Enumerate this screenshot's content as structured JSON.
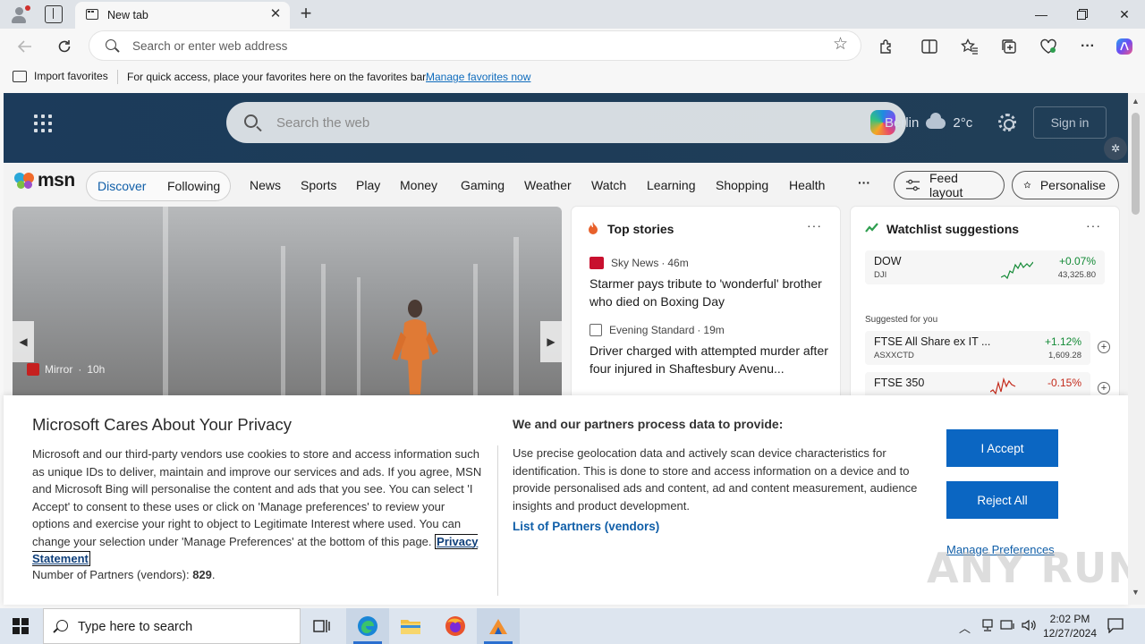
{
  "browser": {
    "tab_title": "New tab",
    "address_placeholder": "Search or enter web address",
    "favorites_bar": {
      "import_label": "Import favorites",
      "message": "For quick access, place your favorites here on the favorites bar.",
      "link": "Manage favorites now"
    }
  },
  "msn": {
    "search_placeholder": "Search the web",
    "city": "Berlin",
    "temperature": "2°c",
    "sign_in": "Sign in",
    "logo_text": "msn",
    "segments": [
      "Discover",
      "Following"
    ],
    "nav_items": [
      "News",
      "Sports",
      "Play",
      "Money",
      "Gaming",
      "Weather",
      "Watch",
      "Learning",
      "Shopping",
      "Health"
    ],
    "more": "···",
    "feed_layout": "Feed layout",
    "personalise": "Personalise",
    "hero": {
      "source": "Mirror",
      "age": "10h"
    },
    "top_stories": {
      "title": "Top stories",
      "items": [
        {
          "source": "Sky News",
          "age": "46m",
          "headline": "Starmer pays tribute to 'wonderful' brother who died on Boxing Day"
        },
        {
          "source": "Evening Standard",
          "age": "19m",
          "headline": "Driver charged with attempted murder after four injured in Shaftesbury Avenu..."
        }
      ]
    },
    "watchlist": {
      "title": "Watchlist suggestions",
      "main": {
        "name": "DOW",
        "symbol": "DJI",
        "change": "+0.07%",
        "price": "43,325.80",
        "direction": "up"
      },
      "suggested_label": "Suggested for you",
      "suggested": [
        {
          "name": "FTSE All Share ex IT ...",
          "symbol": "ASXXCTD",
          "change": "+1.12%",
          "price": "1,609.28",
          "direction": "up"
        },
        {
          "name": "FTSE 350",
          "symbol": "",
          "change": "-0.15%",
          "price": "",
          "direction": "down"
        }
      ]
    }
  },
  "consent": {
    "title": "Microsoft Cares About Your Privacy",
    "body": "Microsoft and our third-party vendors use cookies to store and access information such as unique IDs to deliver, maintain and improve our services and ads. If you agree, MSN and Microsoft Bing will personalise the content and ads that you see. You can select 'I Accept' to consent to these uses or click on 'Manage preferences' to review your options and exercise your right to object to Legitimate Interest where used.  You can change your selection under 'Manage Preferences' at the bottom of this page.",
    "privacy_link": "Privacy Statement",
    "partners_label": "Number of Partners (vendors):",
    "partners_count": "829",
    "partners_suffix": ".",
    "purposes_title": "We and our partners process data to provide:",
    "purposes_body": "Use precise geolocation data and actively scan device characteristics for identification. This is done to store and access information on a device and to provide personalised ads and content, ad and content measurement, audience insights and product development.",
    "vendors_link": "List of Partners (vendors)",
    "accept": "I Accept",
    "reject": "Reject All",
    "manage": "Manage Preferences"
  },
  "watermark": "ANY RUN",
  "taskbar": {
    "search_placeholder": "Type here to search",
    "time": "2:02 PM",
    "date": "12/27/2024"
  },
  "colors": {
    "accent": "#0b66c2",
    "positive": "#138a36",
    "negative": "#c42b1c",
    "hero_bg": "#1d3c58"
  }
}
